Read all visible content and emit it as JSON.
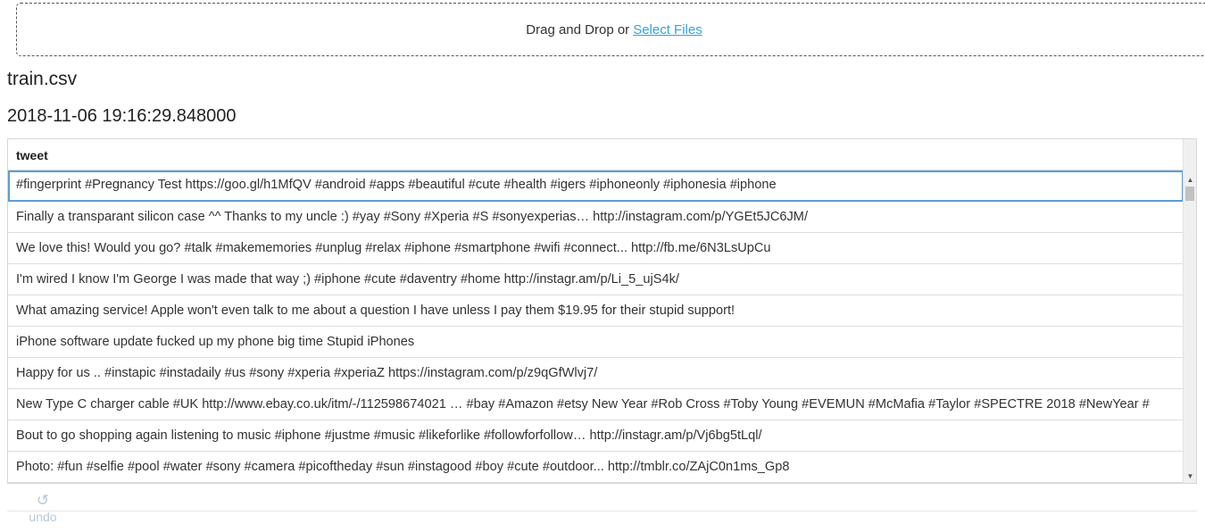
{
  "upload": {
    "prompt": "Drag and Drop or",
    "select_link": "Select Files"
  },
  "file": {
    "name": "train.csv",
    "timestamp": "2018-11-06 19:16:29.848000"
  },
  "table": {
    "column": "tweet",
    "rows": [
      "#fingerprint #Pregnancy Test https://goo.gl/h1MfQV #android #apps #beautiful #cute #health #igers #iphoneonly #iphonesia #iphone",
      "Finally a transparant silicon case ^^ Thanks to my uncle :) #yay #Sony #Xperia #S #sonyexperias… http://instagram.com/p/YGEt5JC6JM/",
      "We love this! Would you go? #talk #makememories #unplug #relax #iphone #smartphone #wifi #connect... http://fb.me/6N3LsUpCu",
      "I'm wired I know I'm George I was made that way ;) #iphone #cute #daventry #home http://instagr.am/p/Li_5_ujS4k/",
      "What amazing service! Apple won't even talk to me about a question I have unless I pay them $19.95 for their stupid support!",
      "iPhone software update fucked up my phone big time Stupid iPhones",
      "Happy for us .. #instapic #instadaily #us #sony #xperia #xperiaZ https://instagram.com/p/z9qGfWlvj7/",
      "New Type C charger cable #UK http://www.ebay.co.uk/itm/-/112598674021 … #bay #Amazon #etsy New Year #Rob Cross #Toby Young #EVEMUN #McMafia #Taylor #SPECTRE 2018 #NewYear #",
      "Bout to go shopping again listening to music #iphone #justme #music #likeforlike #followforfollow… http://instagr.am/p/Vj6bg5tLql/",
      "Photo: #fun #selfie #pool #water #sony #camera #picoftheday #sun #instagood #boy #cute #outdoor... http://tmblr.co/ZAjC0n1ms_Gp8"
    ],
    "active_row": 0
  },
  "actions": {
    "undo_label": "undo",
    "undo_icon": "↺"
  },
  "colors": {
    "link": "#35a3d3",
    "active_outline": "#5c9dd6",
    "undo": "#b7c9d6"
  },
  "icons": {
    "undo": "undo-icon",
    "scroll_up": "scroll-up-arrow-icon",
    "scroll_down": "scroll-down-arrow-icon"
  }
}
